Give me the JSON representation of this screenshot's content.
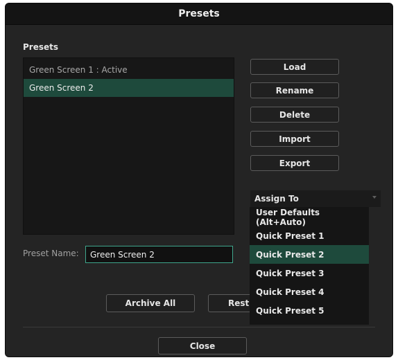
{
  "window": {
    "title": "Presets"
  },
  "presets": {
    "section_label": "Presets",
    "items": [
      {
        "label": "Green Screen 1 : Active",
        "state": "active"
      },
      {
        "label": "Green Screen 2",
        "state": "selected"
      }
    ]
  },
  "actions": {
    "load": "Load",
    "rename": "Rename",
    "delete": "Delete",
    "import": "Import",
    "export": "Export"
  },
  "assign": {
    "label": "Assign To",
    "options": [
      {
        "label": "User Defaults (Alt+Auto)"
      },
      {
        "label": "Quick Preset 1"
      },
      {
        "label": "Quick Preset 2",
        "highlighted": true
      },
      {
        "label": "Quick Preset 3"
      },
      {
        "label": "Quick Preset 4"
      },
      {
        "label": "Quick Preset 5"
      }
    ]
  },
  "preset_name": {
    "label": "Preset Name:",
    "value": "Green Screen 2"
  },
  "footer": {
    "archive_all": "Archive All",
    "restore_partial": "Rest",
    "close": "Close"
  },
  "colors": {
    "selection": "#1e4a3c",
    "focus_border": "#3fa78c",
    "background": "#242424"
  }
}
